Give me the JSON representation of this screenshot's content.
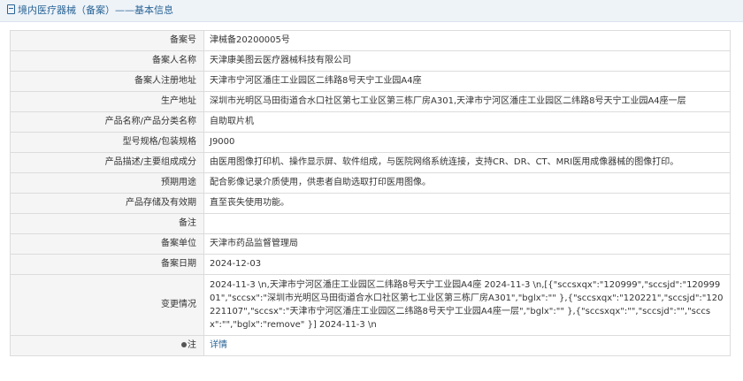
{
  "header": {
    "title": "境内医疗器械（备案）",
    "subtitle": "——基本信息"
  },
  "rows": [
    {
      "label": "备案号",
      "value": "津械备20200005号"
    },
    {
      "label": "备案人名称",
      "value": "天津康美图云医疗器械科技有限公司"
    },
    {
      "label": "备案人注册地址",
      "value": "天津市宁河区潘庄工业园区二纬路8号天宁工业园A4座"
    },
    {
      "label": "生产地址",
      "value": "深圳市光明区马田街道合水口社区第七工业区第三栋厂房A301,天津市宁河区潘庄工业园区二纬路8号天宁工业园A4座一层"
    },
    {
      "label": "产品名称/产品分类名称",
      "value": "自助取片机"
    },
    {
      "label": "型号规格/包装规格",
      "value": "J9000"
    },
    {
      "label": "产品描述/主要组成成分",
      "value": "由医用图像打印机、操作显示屏、软件组成，与医院网络系统连接，支持CR、DR、CT、MRI医用成像器械的图像打印。"
    },
    {
      "label": "预期用途",
      "value": "配合影像记录介质使用，供患者自助选取打印医用图像。"
    },
    {
      "label": "产品存储及有效期",
      "value": "直至丧失使用功能。"
    },
    {
      "label": "备注",
      "value": ""
    },
    {
      "label": "备案单位",
      "value": "天津市药品监督管理局"
    },
    {
      "label": "备案日期",
      "value": "2024-12-03"
    }
  ],
  "change": {
    "label": "变更情况",
    "value": "2024-11-3 \\n,天津市宁河区潘庄工业园区二纬路8号天宁工业园A4座 2024-11-3 \\n,[{\"sccsxqx\":\"120999\",\"sccsjd\":\"12099901\",\"sccsx\":\"深圳市光明区马田街道合水口社区第七工业区第三栋厂房A301\",\"bglx\":\"\" },{\"sccsxqx\":\"120221\",\"sccsjd\":\"120221107\",\"sccsx\":\"天津市宁河区潘庄工业园区二纬路8号天宁工业园A4座一层\",\"bglx\":\"\" },{\"sccsxqx\":\"\",\"sccsjd\":\"\",\"sccsx\":\"\",\"bglx\":\"remove\" }] 2024-11-3 \\n"
  },
  "note": {
    "label": "注",
    "icon": "pin-icon",
    "link_text": "详情"
  },
  "colors": {
    "accent": "#2a6496",
    "label_bg": "#f5f5f5",
    "border": "#dcdcdc",
    "header_bg": "#eef3f8"
  }
}
